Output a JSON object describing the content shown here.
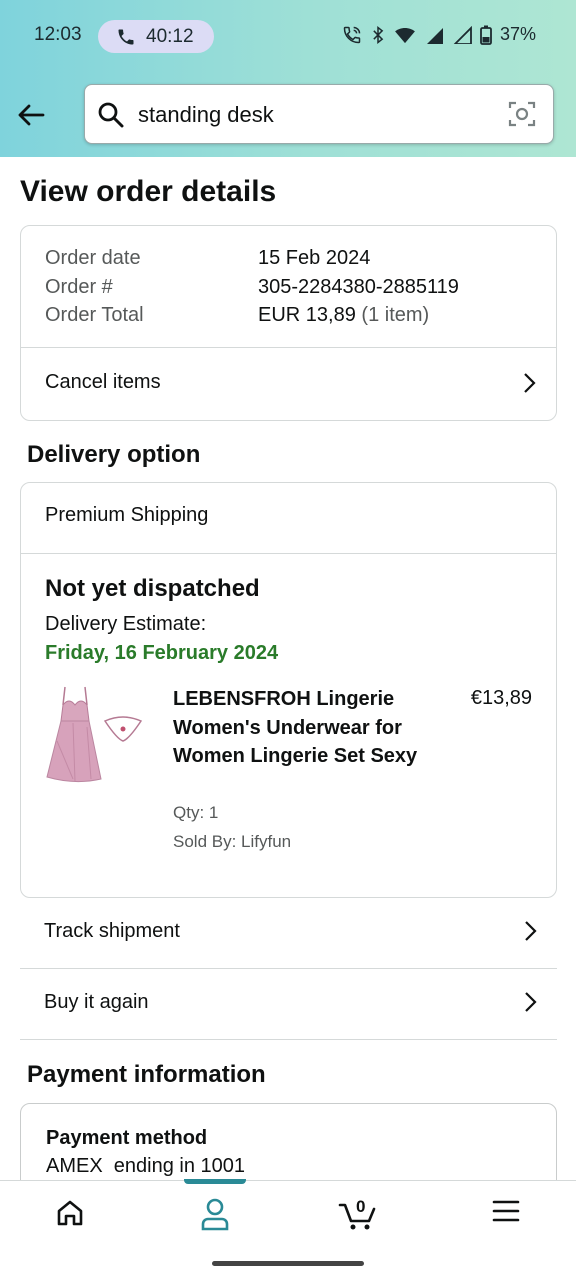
{
  "status_bar": {
    "time": "12:03",
    "call_duration": "40:12",
    "battery": "37%"
  },
  "search": {
    "value": "standing desk"
  },
  "page": {
    "title": "View order details"
  },
  "order": {
    "date_label": "Order date",
    "date_value": "15 Feb 2024",
    "number_label": "Order #",
    "number_value": "305-2284380-2885119",
    "total_label": "Order Total",
    "total_value": "EUR 13,89",
    "total_items": "(1 item)",
    "cancel_label": "Cancel items"
  },
  "delivery": {
    "section_title": "Delivery option",
    "method": "Premium Shipping",
    "status": "Not yet dispatched",
    "estimate_label": "Delivery Estimate:",
    "estimate_date": "Friday, 16 February 2024",
    "product": {
      "name": "LEBENSFROH Lingerie Women's Underwear for Women Lingerie Set Sexy",
      "price": "€13,89",
      "qty": "Qty: 1",
      "seller": "Sold By: Lifyfun"
    }
  },
  "actions": {
    "track": "Track shipment",
    "buy_again": "Buy it again"
  },
  "payment": {
    "section_title": "Payment information",
    "method_label": "Payment method",
    "method_value": "AMEX  ending in 1001"
  },
  "nav": {
    "cart_count": "0",
    "items": [
      "home-icon",
      "account-icon",
      "cart-icon",
      "menu-icon"
    ],
    "accent_color": "#2a8a96"
  },
  "colors": {
    "header_gradient_start": "#7fd3dc",
    "header_gradient_end": "#aee6d3",
    "estimate_green": "#2a7b2a"
  }
}
